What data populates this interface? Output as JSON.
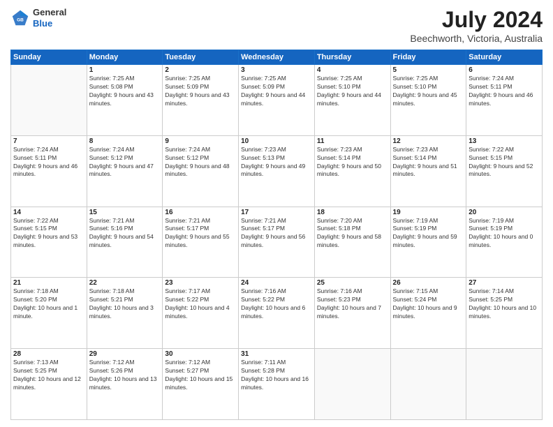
{
  "header": {
    "logo_general": "General",
    "logo_blue": "Blue",
    "main_title": "July 2024",
    "subtitle": "Beechworth, Victoria, Australia"
  },
  "days_of_week": [
    "Sunday",
    "Monday",
    "Tuesday",
    "Wednesday",
    "Thursday",
    "Friday",
    "Saturday"
  ],
  "weeks": [
    [
      {
        "day": "",
        "sunrise": "",
        "sunset": "",
        "daylight": ""
      },
      {
        "day": "1",
        "sunrise": "Sunrise: 7:25 AM",
        "sunset": "Sunset: 5:08 PM",
        "daylight": "Daylight: 9 hours and 43 minutes."
      },
      {
        "day": "2",
        "sunrise": "Sunrise: 7:25 AM",
        "sunset": "Sunset: 5:09 PM",
        "daylight": "Daylight: 9 hours and 43 minutes."
      },
      {
        "day": "3",
        "sunrise": "Sunrise: 7:25 AM",
        "sunset": "Sunset: 5:09 PM",
        "daylight": "Daylight: 9 hours and 44 minutes."
      },
      {
        "day": "4",
        "sunrise": "Sunrise: 7:25 AM",
        "sunset": "Sunset: 5:10 PM",
        "daylight": "Daylight: 9 hours and 44 minutes."
      },
      {
        "day": "5",
        "sunrise": "Sunrise: 7:25 AM",
        "sunset": "Sunset: 5:10 PM",
        "daylight": "Daylight: 9 hours and 45 minutes."
      },
      {
        "day": "6",
        "sunrise": "Sunrise: 7:24 AM",
        "sunset": "Sunset: 5:11 PM",
        "daylight": "Daylight: 9 hours and 46 minutes."
      }
    ],
    [
      {
        "day": "7",
        "sunrise": "Sunrise: 7:24 AM",
        "sunset": "Sunset: 5:11 PM",
        "daylight": "Daylight: 9 hours and 46 minutes."
      },
      {
        "day": "8",
        "sunrise": "Sunrise: 7:24 AM",
        "sunset": "Sunset: 5:12 PM",
        "daylight": "Daylight: 9 hours and 47 minutes."
      },
      {
        "day": "9",
        "sunrise": "Sunrise: 7:24 AM",
        "sunset": "Sunset: 5:12 PM",
        "daylight": "Daylight: 9 hours and 48 minutes."
      },
      {
        "day": "10",
        "sunrise": "Sunrise: 7:23 AM",
        "sunset": "Sunset: 5:13 PM",
        "daylight": "Daylight: 9 hours and 49 minutes."
      },
      {
        "day": "11",
        "sunrise": "Sunrise: 7:23 AM",
        "sunset": "Sunset: 5:14 PM",
        "daylight": "Daylight: 9 hours and 50 minutes."
      },
      {
        "day": "12",
        "sunrise": "Sunrise: 7:23 AM",
        "sunset": "Sunset: 5:14 PM",
        "daylight": "Daylight: 9 hours and 51 minutes."
      },
      {
        "day": "13",
        "sunrise": "Sunrise: 7:22 AM",
        "sunset": "Sunset: 5:15 PM",
        "daylight": "Daylight: 9 hours and 52 minutes."
      }
    ],
    [
      {
        "day": "14",
        "sunrise": "Sunrise: 7:22 AM",
        "sunset": "Sunset: 5:15 PM",
        "daylight": "Daylight: 9 hours and 53 minutes."
      },
      {
        "day": "15",
        "sunrise": "Sunrise: 7:21 AM",
        "sunset": "Sunset: 5:16 PM",
        "daylight": "Daylight: 9 hours and 54 minutes."
      },
      {
        "day": "16",
        "sunrise": "Sunrise: 7:21 AM",
        "sunset": "Sunset: 5:17 PM",
        "daylight": "Daylight: 9 hours and 55 minutes."
      },
      {
        "day": "17",
        "sunrise": "Sunrise: 7:21 AM",
        "sunset": "Sunset: 5:17 PM",
        "daylight": "Daylight: 9 hours and 56 minutes."
      },
      {
        "day": "18",
        "sunrise": "Sunrise: 7:20 AM",
        "sunset": "Sunset: 5:18 PM",
        "daylight": "Daylight: 9 hours and 58 minutes."
      },
      {
        "day": "19",
        "sunrise": "Sunrise: 7:19 AM",
        "sunset": "Sunset: 5:19 PM",
        "daylight": "Daylight: 9 hours and 59 minutes."
      },
      {
        "day": "20",
        "sunrise": "Sunrise: 7:19 AM",
        "sunset": "Sunset: 5:19 PM",
        "daylight": "Daylight: 10 hours and 0 minutes."
      }
    ],
    [
      {
        "day": "21",
        "sunrise": "Sunrise: 7:18 AM",
        "sunset": "Sunset: 5:20 PM",
        "daylight": "Daylight: 10 hours and 1 minute."
      },
      {
        "day": "22",
        "sunrise": "Sunrise: 7:18 AM",
        "sunset": "Sunset: 5:21 PM",
        "daylight": "Daylight: 10 hours and 3 minutes."
      },
      {
        "day": "23",
        "sunrise": "Sunrise: 7:17 AM",
        "sunset": "Sunset: 5:22 PM",
        "daylight": "Daylight: 10 hours and 4 minutes."
      },
      {
        "day": "24",
        "sunrise": "Sunrise: 7:16 AM",
        "sunset": "Sunset: 5:22 PM",
        "daylight": "Daylight: 10 hours and 6 minutes."
      },
      {
        "day": "25",
        "sunrise": "Sunrise: 7:16 AM",
        "sunset": "Sunset: 5:23 PM",
        "daylight": "Daylight: 10 hours and 7 minutes."
      },
      {
        "day": "26",
        "sunrise": "Sunrise: 7:15 AM",
        "sunset": "Sunset: 5:24 PM",
        "daylight": "Daylight: 10 hours and 9 minutes."
      },
      {
        "day": "27",
        "sunrise": "Sunrise: 7:14 AM",
        "sunset": "Sunset: 5:25 PM",
        "daylight": "Daylight: 10 hours and 10 minutes."
      }
    ],
    [
      {
        "day": "28",
        "sunrise": "Sunrise: 7:13 AM",
        "sunset": "Sunset: 5:25 PM",
        "daylight": "Daylight: 10 hours and 12 minutes."
      },
      {
        "day": "29",
        "sunrise": "Sunrise: 7:12 AM",
        "sunset": "Sunset: 5:26 PM",
        "daylight": "Daylight: 10 hours and 13 minutes."
      },
      {
        "day": "30",
        "sunrise": "Sunrise: 7:12 AM",
        "sunset": "Sunset: 5:27 PM",
        "daylight": "Daylight: 10 hours and 15 minutes."
      },
      {
        "day": "31",
        "sunrise": "Sunrise: 7:11 AM",
        "sunset": "Sunset: 5:28 PM",
        "daylight": "Daylight: 10 hours and 16 minutes."
      },
      {
        "day": "",
        "sunrise": "",
        "sunset": "",
        "daylight": ""
      },
      {
        "day": "",
        "sunrise": "",
        "sunset": "",
        "daylight": ""
      },
      {
        "day": "",
        "sunrise": "",
        "sunset": "",
        "daylight": ""
      }
    ]
  ]
}
